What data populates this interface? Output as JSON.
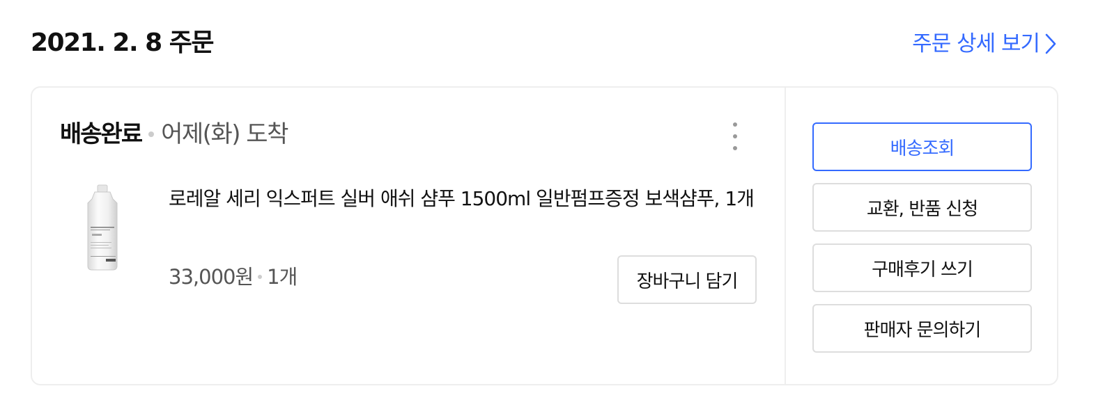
{
  "order": {
    "date_title": "2021. 2. 8 주문",
    "detail_link": "주문 상세 보기"
  },
  "shipment": {
    "status": "배송완료",
    "arrival": "어제(화) 도착"
  },
  "product": {
    "name": "로레알 세리 익스퍼트 실버 애쉬 샴푸 1500ml 일반펌프증정 보색샴푸, 1개",
    "price": "33,000원",
    "quantity": "1개",
    "cart_button": "장바구니 담기"
  },
  "actions": [
    {
      "label": "배송조회"
    },
    {
      "label": "교환, 반품 신청"
    },
    {
      "label": "구매후기 쓰기"
    },
    {
      "label": "판매자 문의하기"
    }
  ],
  "colors": {
    "accent": "#346aff",
    "border": "#dddddd",
    "divider": "#eeeeee",
    "text_primary": "#111111",
    "text_secondary": "#555555"
  },
  "icons": {
    "detail_link": "chevron-right-icon",
    "more": "more-vertical-icon"
  }
}
